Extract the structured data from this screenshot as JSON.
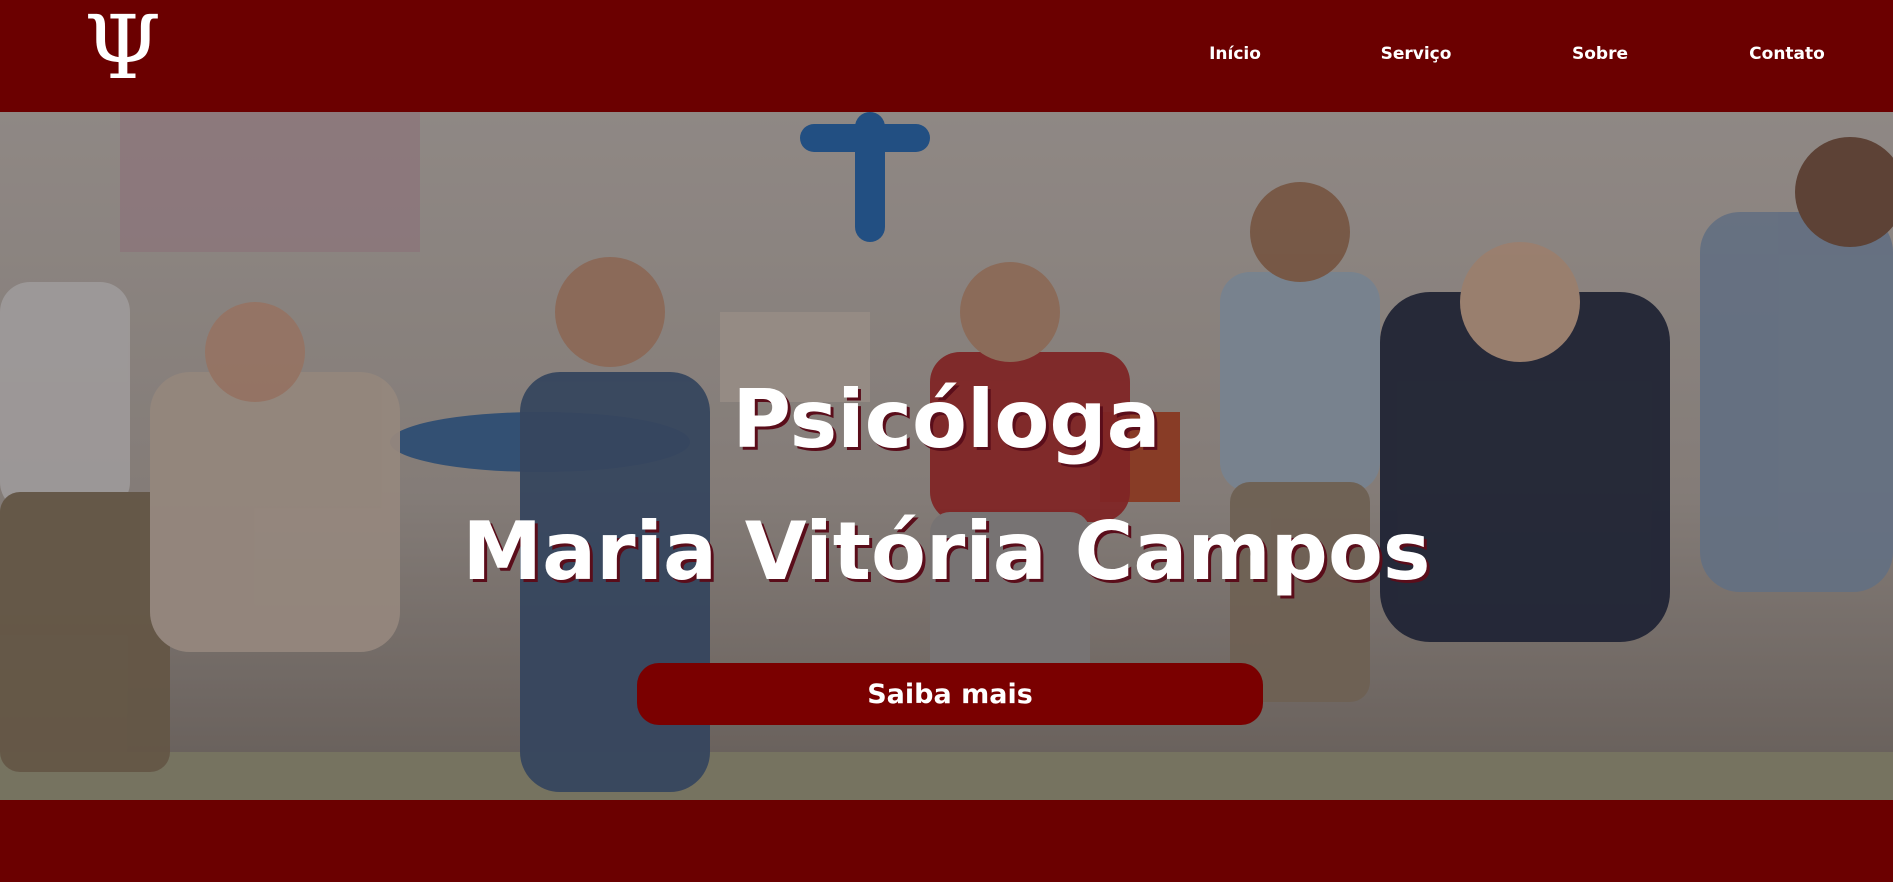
{
  "header": {
    "logo_glyph": "Ψ",
    "nav": [
      {
        "label": "Início"
      },
      {
        "label": "Serviço"
      },
      {
        "label": "Sobre"
      },
      {
        "label": "Contato"
      }
    ]
  },
  "hero": {
    "title_line1": "Psicóloga",
    "title_line2": "Maria Vitória Campos",
    "cta_label": "Saiba mais"
  },
  "colors": {
    "brand": "#6b0000",
    "button": "#7a0000",
    "text": "#ffffff"
  }
}
